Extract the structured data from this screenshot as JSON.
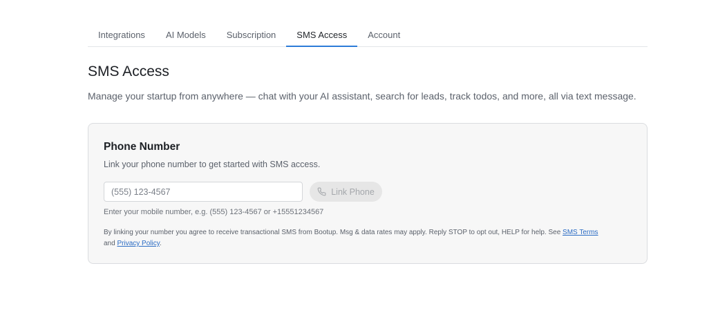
{
  "tabs": [
    {
      "label": "Integrations",
      "active": false
    },
    {
      "label": "AI Models",
      "active": false
    },
    {
      "label": "Subscription",
      "active": false
    },
    {
      "label": "SMS Access",
      "active": true
    },
    {
      "label": "Account",
      "active": false
    }
  ],
  "page": {
    "title": "SMS Access",
    "description": "Manage your startup from anywhere — chat with your AI assistant, search for leads, track todos, and more, all via text message."
  },
  "card": {
    "title": "Phone Number",
    "description": "Link your phone number to get started with SMS access.",
    "phone_input": {
      "placeholder": "(555) 123-4567",
      "value": ""
    },
    "link_button": {
      "label": "Link Phone",
      "icon": "phone-icon",
      "disabled": true
    },
    "hint": "Enter your mobile number, e.g. (555) 123-4567 or +15551234567",
    "legal": {
      "text_before": "By linking your number you agree to receive transactional SMS from Bootup. Msg & data rates may apply. Reply STOP to opt out, HELP for help. See ",
      "terms_link": "SMS Terms",
      "text_middle": " and ",
      "privacy_link": "Privacy Policy",
      "text_after": "."
    }
  },
  "colors": {
    "accent": "#2b7bd8",
    "link": "#2b6cc4",
    "card_bg": "#f7f7f7"
  }
}
